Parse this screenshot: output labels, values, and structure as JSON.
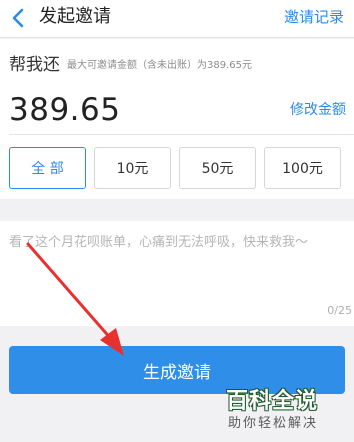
{
  "header": {
    "title": "发起邀请",
    "records_label": "邀请记录"
  },
  "invite": {
    "label": "帮我还",
    "limit_text": "最大可邀请金额（含未出账）为389.65元",
    "amount": "389.65",
    "edit_label": "修改金额"
  },
  "amount_options": [
    "全 部",
    "10元",
    "50元",
    "100元"
  ],
  "message": {
    "text": "看了这个月花呗账单，心痛到无法呼吸，快来救我～",
    "counter": "0/25"
  },
  "generate_label": "生成邀请",
  "watermark": {
    "line1": "百科全说",
    "line2": "助你轻松解决"
  },
  "colors": {
    "accent": "#2b8be8",
    "button": "#2f8ee8",
    "annotation_arrow": "#e8302e"
  }
}
